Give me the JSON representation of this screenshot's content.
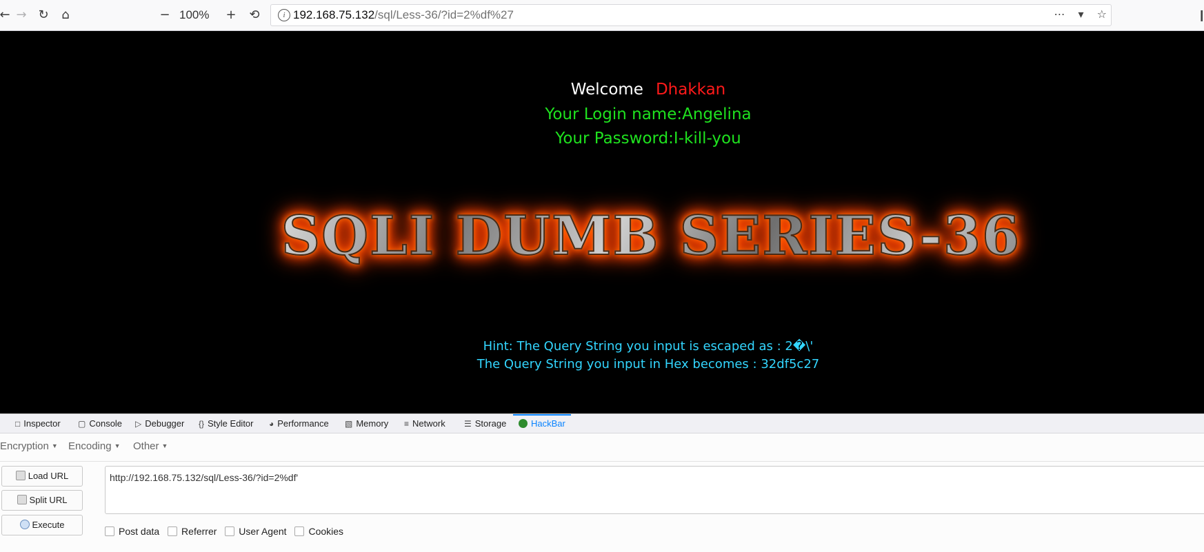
{
  "browser": {
    "zoom": "100%",
    "url_host": "192.168.75.132",
    "url_path": "/sql/Less-36/?id=2%df%27"
  },
  "page": {
    "welcome_label": "Welcome",
    "welcome_name": "Dhakkan",
    "login_line": "Your Login name:Angelina",
    "password_line": "Your Password:I-kill-you",
    "banner": "SQLI DUMB SERIES-36",
    "hint_line": "Hint: The Query String you input is escaped as : 2�\\'",
    "hex_line": "The Query String you input in Hex becomes : 32df5c27"
  },
  "devtools": {
    "tabs": [
      "Inspector",
      "Console",
      "Debugger",
      "Style Editor",
      "Performance",
      "Memory",
      "Network",
      "Storage",
      "HackBar"
    ],
    "active_tab": "HackBar"
  },
  "hackbar": {
    "menus": [
      "Encryption",
      "Encoding",
      "Other"
    ],
    "buttons": {
      "load": "Load URL",
      "split": "Split URL",
      "execute": "Execute"
    },
    "url_value": "http://192.168.75.132/sql/Less-36/?id=2%df'",
    "checkboxes": [
      "Post data",
      "Referrer",
      "User Agent",
      "Cookies"
    ]
  },
  "colors": {
    "welcome_name": "#ff1a1a",
    "login": "#1fe21f",
    "hint": "#33d6ff",
    "banner_glow": "#ff6a00",
    "active_tab": "#0a84ff"
  }
}
